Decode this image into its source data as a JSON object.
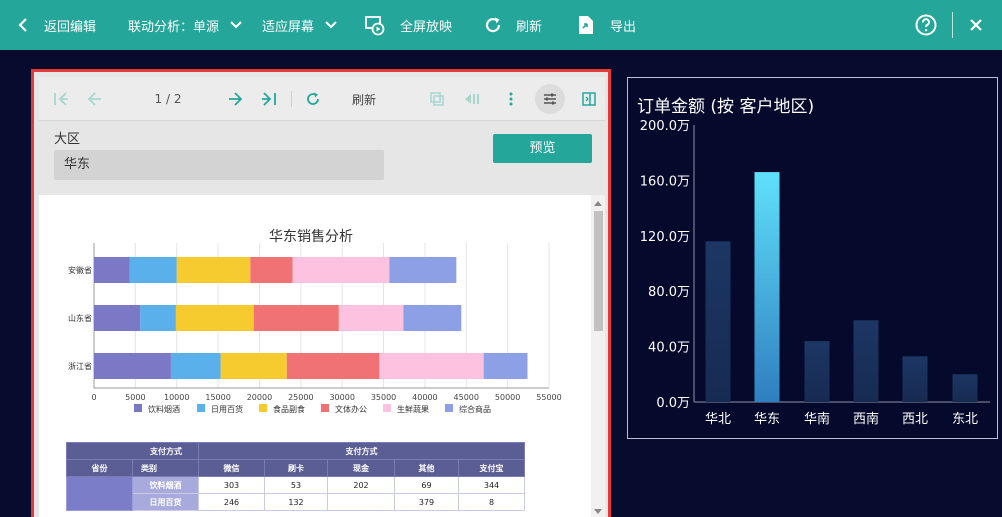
{
  "topbar": {
    "back_label": "返回编辑",
    "linkage_label": "联动分析：单源",
    "fit_label": "适应屏幕",
    "fullscreen_label": "全屏放映",
    "refresh_label": "刷新",
    "export_label": "导出"
  },
  "report_toolbar": {
    "page_indicator": "1 / 2",
    "refresh_label": "刷新"
  },
  "params": {
    "region_label": "大区",
    "region_value": "华东",
    "preview_label": "预览"
  },
  "sales_chart": {
    "title": "华东销售分析",
    "legend": [
      "饮料烟酒",
      "日用百货",
      "食品副食",
      "文体办公",
      "生鲜蔬果",
      "综合商品"
    ],
    "colors": [
      "#7b79c6",
      "#5ab0ea",
      "#f5cb2f",
      "#f07274",
      "#fdc2e0",
      "#8da0e6"
    ],
    "xticks": [
      "0",
      "5000",
      "10000",
      "15000",
      "20000",
      "25000",
      "30000",
      "35000",
      "40000",
      "45000",
      "50000",
      "55000"
    ]
  },
  "chart_data": [
    {
      "type": "bar",
      "orientation": "horizontal",
      "stacked": true,
      "title": "华东销售分析",
      "categories": [
        "安徽省",
        "山东省",
        "浙江省"
      ],
      "series": [
        {
          "name": "饮料烟酒",
          "values": [
            4300,
            5600,
            9300
          ]
        },
        {
          "name": "日用百货",
          "values": [
            5700,
            4300,
            6000
          ]
        },
        {
          "name": "食品副食",
          "values": [
            8900,
            9400,
            8000
          ]
        },
        {
          "name": "文体办公",
          "values": [
            5100,
            10300,
            11200
          ]
        },
        {
          "name": "生鲜蔬果",
          "values": [
            11700,
            7800,
            12600
          ]
        },
        {
          "name": "综合商品",
          "values": [
            8100,
            7000,
            5300
          ]
        }
      ],
      "xlim": [
        0,
        55000
      ],
      "grid": true,
      "legend_position": "bottom"
    },
    {
      "type": "bar",
      "title": "订单金额 (按 客户地区)",
      "categories": [
        "华北",
        "华东",
        "华南",
        "西南",
        "西北",
        "东北"
      ],
      "values": [
        1160000,
        1660000,
        440000,
        590000,
        330000,
        200000
      ],
      "yticks": [
        "0.0万",
        "40.0万",
        "80.0万",
        "120.0万",
        "160.0万",
        "200.0万"
      ],
      "ylim": [
        0,
        2000000
      ],
      "highlighted": "华东"
    }
  ],
  "table": {
    "corner_top": "支付方式",
    "corner_mid": "类别",
    "corner_left": "省份",
    "group_header": "支付方式",
    "columns": [
      "微信",
      "刷卡",
      "现金",
      "其他",
      "支付宝"
    ],
    "rows": [
      {
        "category": "饮料烟酒",
        "values": [
          "303",
          "53",
          "202",
          "69",
          "344"
        ]
      },
      {
        "category": "日用百货",
        "values": [
          "246",
          "132",
          "",
          "379",
          "8"
        ]
      }
    ]
  },
  "region_chart": {
    "title": "订单金额 (按 客户地区)"
  },
  "colors": {
    "toolbar": "#25a69a",
    "background": "#070c2e",
    "highlight_border": "#e53935"
  }
}
